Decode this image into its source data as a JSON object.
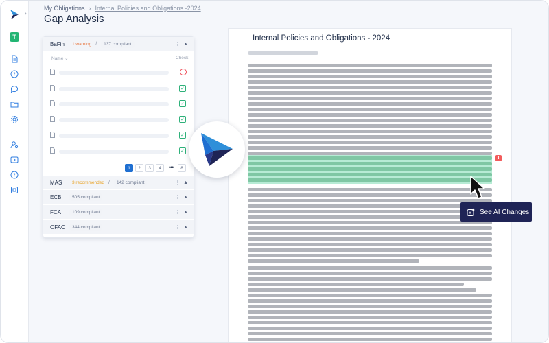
{
  "header": {
    "breadcrumb_root": "My Obligations",
    "breadcrumb_separator": "›",
    "breadcrumb_current": "Internal Policies and Obligations -2024",
    "title": "Gap Analysis"
  },
  "rail": {
    "avatar_initial": "T",
    "expand_glyph": "›",
    "icons": [
      "document-icon",
      "help-icon",
      "chat-icon",
      "folder-icon",
      "settings-icon",
      "user-settings-icon",
      "video-icon",
      "question-icon",
      "report-icon"
    ]
  },
  "regulators": [
    {
      "name": "BaFin",
      "status": "1 warning",
      "status_kind": "warning",
      "compliant": "137 compliant",
      "expanded": true
    },
    {
      "name": "MAS",
      "status": "3 recommended",
      "status_kind": "recommended",
      "compliant": "142 compliant",
      "expanded": false
    },
    {
      "name": "ECB",
      "status": "",
      "status_kind": "none",
      "compliant": "505 compliant",
      "expanded": false
    },
    {
      "name": "FCA",
      "status": "",
      "status_kind": "none",
      "compliant": "109 compliant",
      "expanded": false
    },
    {
      "name": "OFAC",
      "status": "",
      "status_kind": "none",
      "compliant": "344 compliant",
      "expanded": false
    }
  ],
  "table": {
    "name_header": "Name",
    "check_header": "Check",
    "rows": [
      {
        "check": "fail"
      },
      {
        "check": "pass"
      },
      {
        "check": "pass"
      },
      {
        "check": "pass"
      },
      {
        "check": "pass"
      },
      {
        "check": "pass"
      }
    ]
  },
  "pagination": {
    "pages": [
      "1",
      "2",
      "3",
      "4"
    ],
    "ellipsis": "•••",
    "last": "8",
    "current": "1"
  },
  "document": {
    "title": "Internal Policies and Obligations - 2024",
    "alert_glyph": "!"
  },
  "ai_button": {
    "label": "See AI Changes"
  },
  "colors": {
    "brand_navy": "#1f2456",
    "brand_blue": "#1f6fd1",
    "highlight": "#b7ebd5",
    "pass": "#2fb17a",
    "fail": "#ef4c57",
    "warning": "#e8733a",
    "recommended": "#e9a224"
  }
}
